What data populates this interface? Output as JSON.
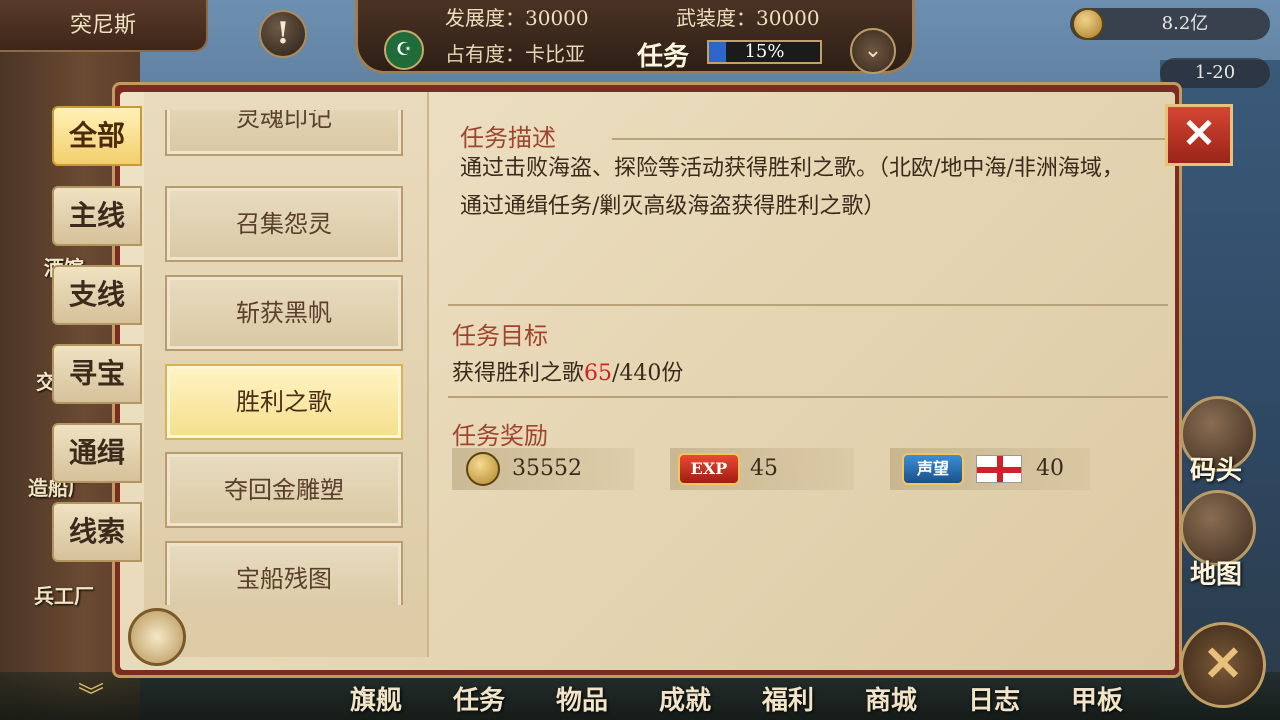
{
  "top_bar": {
    "player_name": "突尼斯",
    "alert_symbol": "!",
    "development": "发展度：30000",
    "armament": "武装度：30000",
    "occupation": "占有度：卡比亚",
    "mission_title": "任务",
    "occupation_progress": 0.15,
    "occupation_progress_text": "15%",
    "dropdown_symbol": "⌄",
    "gold_amount": "8.2亿",
    "level_range": "1-20"
  },
  "background_labels": {
    "tavern": "酒馆",
    "trade": "交",
    "shipyard": "造船厂",
    "arsenal": "兵工厂"
  },
  "tabs": [
    {
      "label": "全部",
      "active": true
    },
    {
      "label": "主线",
      "active": false
    },
    {
      "label": "支线",
      "active": false
    },
    {
      "label": "寻宝",
      "active": false
    },
    {
      "label": "通缉",
      "active": false
    },
    {
      "label": "线索",
      "active": false
    }
  ],
  "quest_list": [
    {
      "label": "灵魂印记",
      "active": false
    },
    {
      "label": "召集怨灵",
      "active": false
    },
    {
      "label": "斩获黑帆",
      "active": false
    },
    {
      "label": "胜利之歌",
      "active": true
    },
    {
      "label": "夺回金雕塑",
      "active": false
    },
    {
      "label": "宝船残图",
      "active": false
    }
  ],
  "detail": {
    "description_title": "任务描述",
    "description": "通过击败海盗、探险等活动获得胜利之歌。（北欧/地中海/非洲海域，通过通缉任务/剿灭高级海盗获得胜利之歌）",
    "goal_title": "任务目标",
    "goal_prefix": "获得胜利之歌",
    "goal_current": "65",
    "goal_suffix": "/440份",
    "reward_title": "任务奖励",
    "rewards": {
      "gold": "35552",
      "exp_badge": "EXP",
      "exp": "45",
      "fame_badge": "声望",
      "fame": "40"
    }
  },
  "close_symbol": "✕",
  "right_buttons": {
    "dock": "码头",
    "map": "地图",
    "action_symbol": "✕"
  },
  "bottom_nav": [
    "旗舰",
    "任务",
    "物品",
    "成就",
    "福利",
    "商城",
    "日志",
    "甲板"
  ],
  "colors": {
    "accent_red": "#a0452c",
    "highlight_red": "#d42020",
    "active_yellow": "#f5df8c",
    "parchment": "#e6d6b4",
    "frame_red": "#7a2b22"
  }
}
